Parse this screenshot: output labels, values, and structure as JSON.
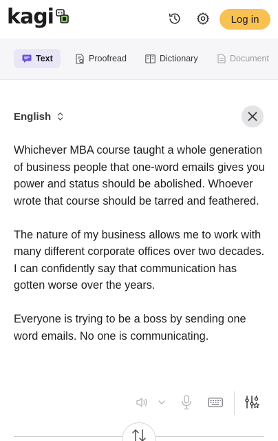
{
  "header": {
    "logo_text": "kagi",
    "login_label": "Log in",
    "icons": {
      "history": "history-clock-icon",
      "settings": "gear-icon",
      "logo": "kagi-doggo-icon"
    },
    "login_color": "#f8c152"
  },
  "tabs": [
    {
      "label": "Text",
      "icon": "chat-bubble-icon",
      "active": true
    },
    {
      "label": "Proofread",
      "icon": "proofread-icon",
      "active": false
    },
    {
      "label": "Dictionary",
      "icon": "book-icon",
      "active": false
    },
    {
      "label": "Document",
      "icon": "document-icon",
      "active": false
    }
  ],
  "language": {
    "label": "English",
    "icon": "chevron-updown-icon"
  },
  "text": {
    "paragraphs": [
      "Whichever MBA course taught a whole generation of business people that one-word emails gives you power and status should be abolished. Whoever wrote that course should be tarred and feathered.",
      "The nature of my business allows me to work with many different corporate offices over two decades. I can confidently say that communication has gotten worse over the years.",
      "Everyone is trying to be a boss by sending one word emails. No one is communicating."
    ]
  },
  "toolbar": {
    "icons": [
      "speaker-icon",
      "chevron-down-icon",
      "microphone-icon",
      "keyboard-icon",
      "tune-settings-icon"
    ]
  },
  "swap": {
    "icon": "swap-arrows-icon"
  },
  "colors": {
    "accent_tab_bg": "#e9e6f7",
    "tab_icon": "#6a4fd8"
  }
}
